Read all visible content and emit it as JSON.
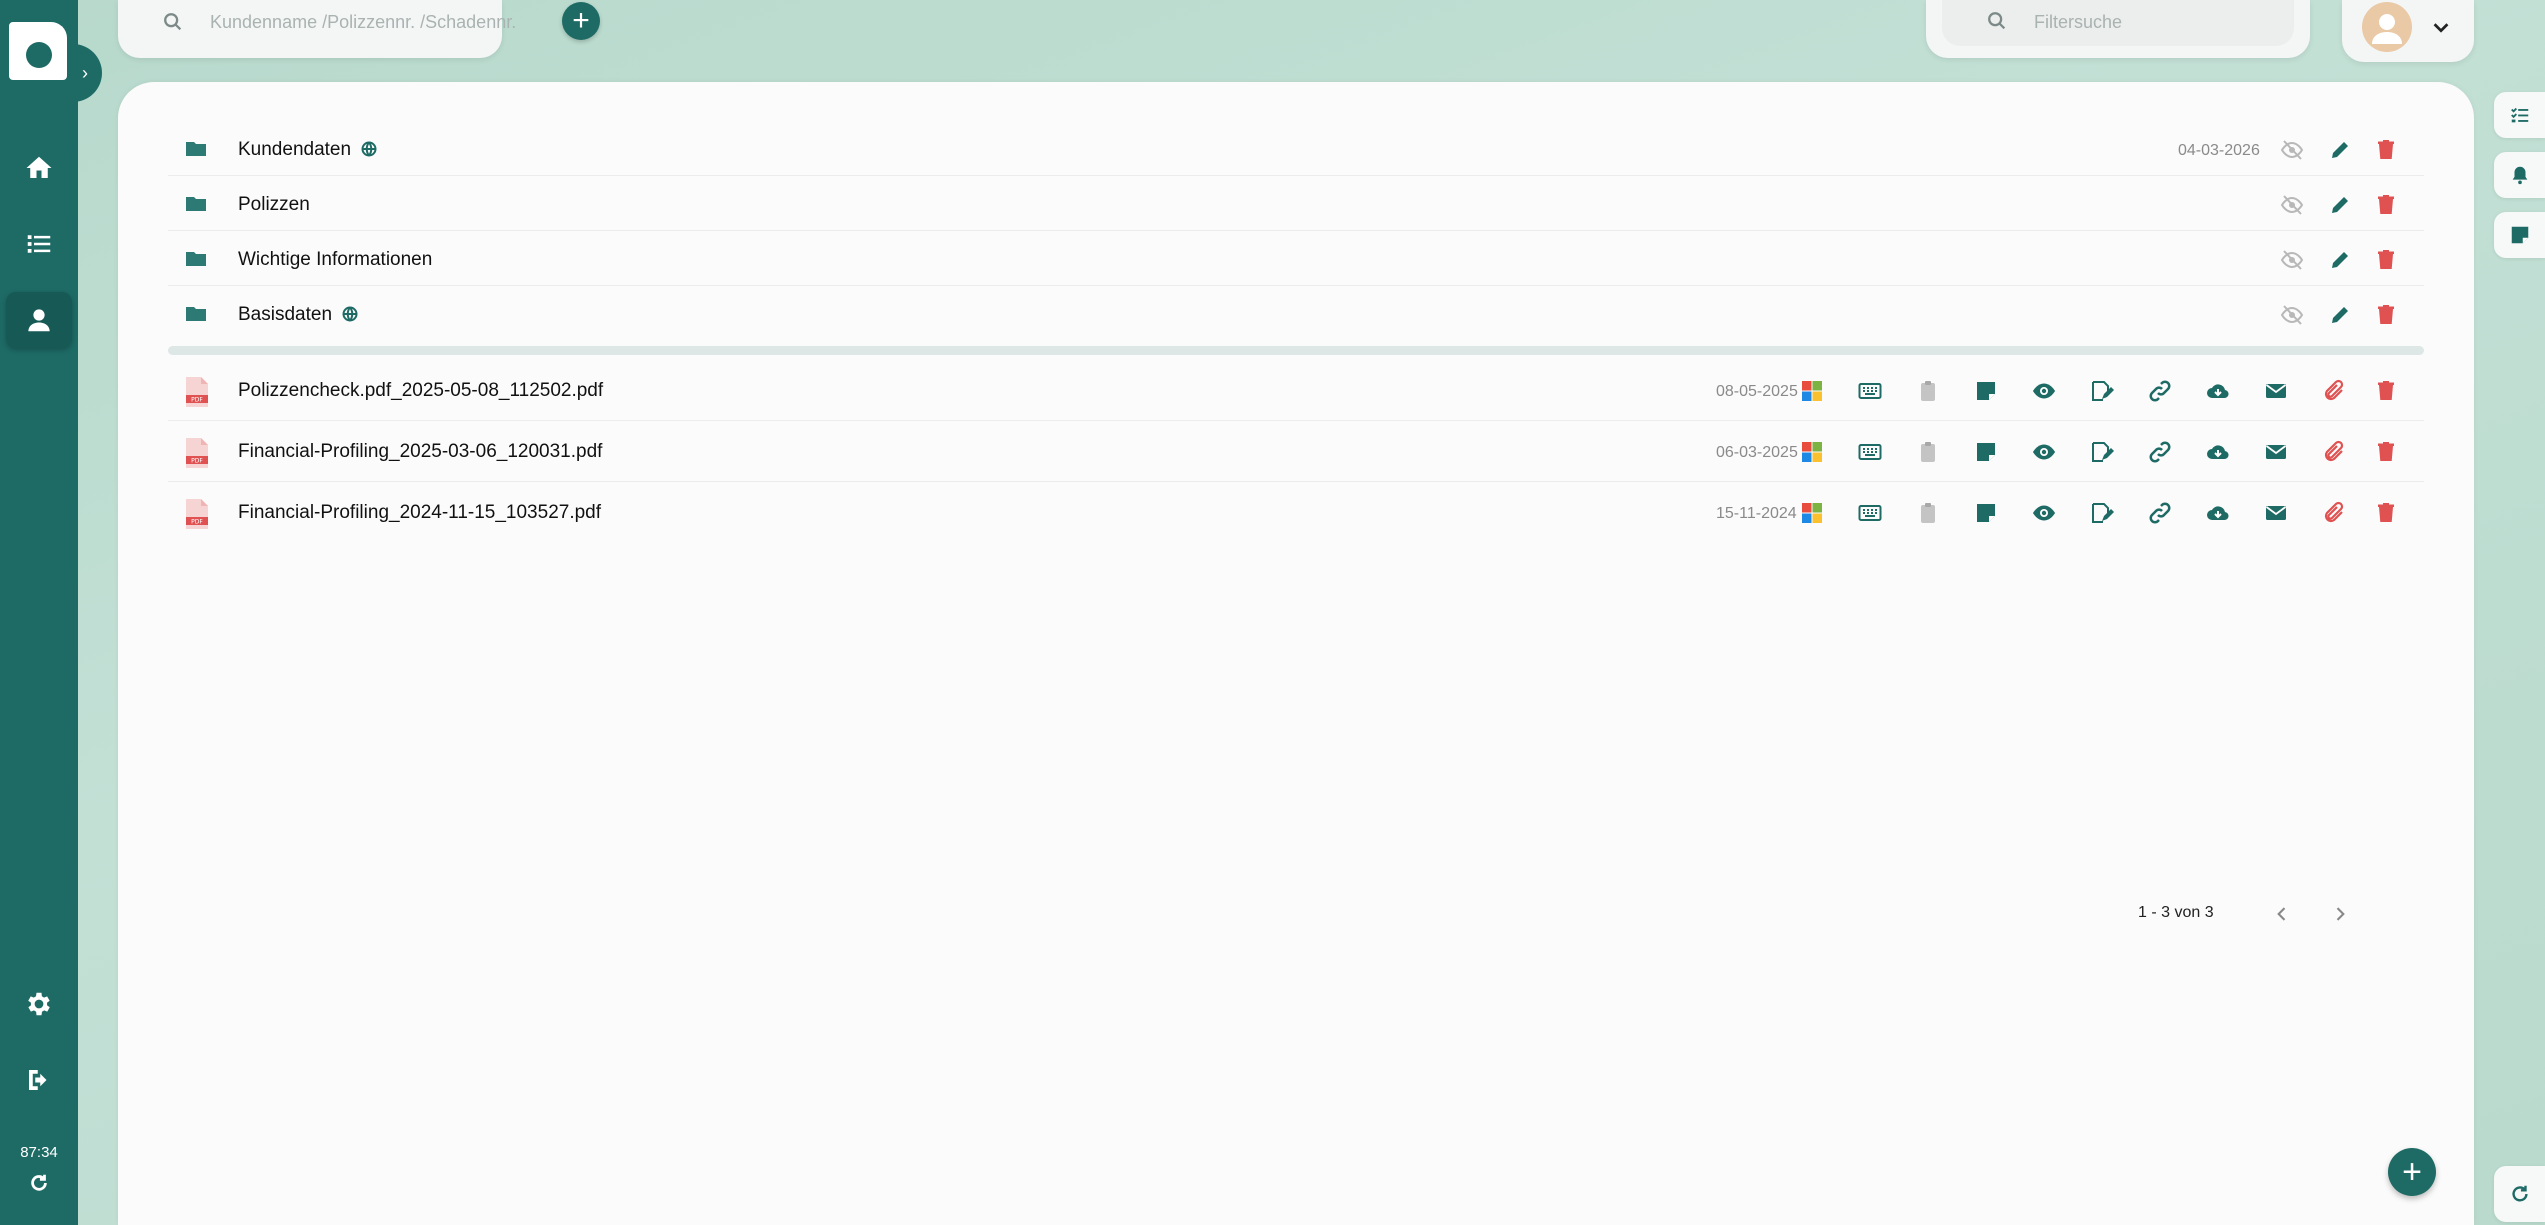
{
  "sidebar": {
    "clock": "87:34",
    "items": [
      {
        "name": "home",
        "icon": "home-icon"
      },
      {
        "name": "list",
        "icon": "list-icon"
      },
      {
        "name": "customer",
        "icon": "user-icon",
        "active": true
      },
      {
        "name": "settings",
        "icon": "gear-icon"
      },
      {
        "name": "logout",
        "icon": "logout-icon"
      }
    ]
  },
  "search": {
    "placeholder": "Kundenname /Polizzennr. /Schadennr."
  },
  "filter": {
    "placeholder": "Filtersuche"
  },
  "folders": [
    {
      "name": "Kundendaten",
      "shared": true,
      "date": "04-03-2026"
    },
    {
      "name": "Polizzen",
      "shared": false,
      "date": ""
    },
    {
      "name": "Wichtige Informationen",
      "shared": false,
      "date": ""
    },
    {
      "name": "Basisdaten",
      "shared": true,
      "date": ""
    }
  ],
  "files": [
    {
      "name": "Polizzencheck.pdf_2025-05-08_112502.pdf",
      "date": "08-05-2025"
    },
    {
      "name": "Financial-Profiling_2025-03-06_120031.pdf",
      "date": "06-03-2025"
    },
    {
      "name": "Financial-Profiling_2024-11-15_103527.pdf",
      "date": "15-11-2024"
    }
  ],
  "pagination": {
    "label": "1 - 3 von 3"
  },
  "colors": {
    "primary": "#1e6b66",
    "danger": "#e05252",
    "muted": "#b8b8b8"
  }
}
